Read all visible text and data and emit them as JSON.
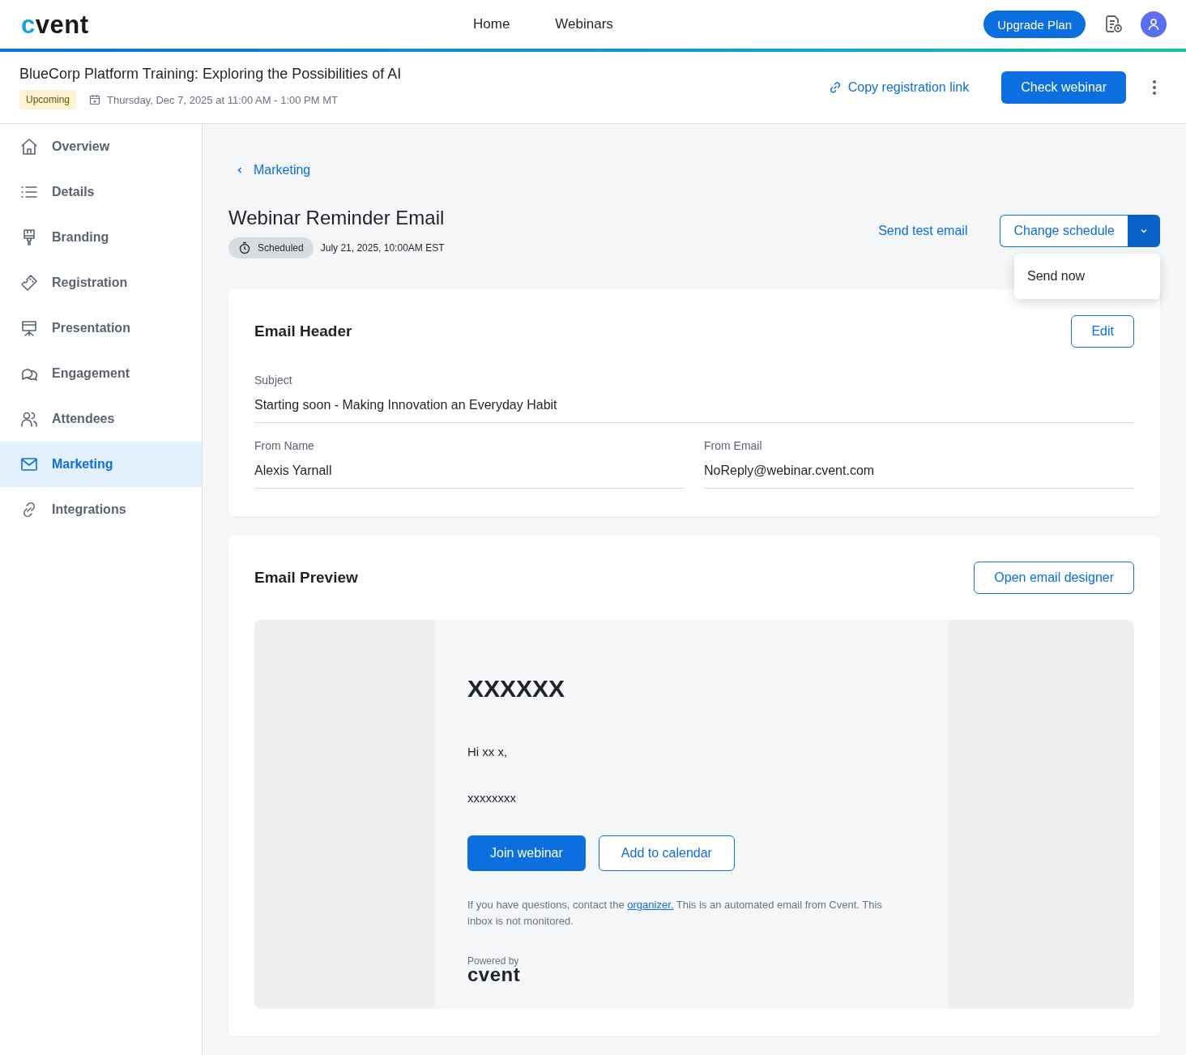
{
  "topbar": {
    "logo": {
      "accent": "c",
      "rest": "vent"
    },
    "nav": [
      {
        "label": "Home",
        "selected": false
      },
      {
        "label": "Webinars",
        "selected": false
      }
    ],
    "upgrade_button": "Upgrade Plan"
  },
  "event": {
    "title": "BlueCorp Platform Training: Exploring the Possibilities of AI",
    "status": "Upcoming",
    "datetime": "Thursday, Dec 7, 2025 at 11:00 AM - 1:00 PM MT",
    "copy_link": "Copy registration link",
    "check_button": "Check webinar"
  },
  "sidebar": {
    "items": [
      {
        "label": "Overview",
        "selected": false
      },
      {
        "label": "Details",
        "selected": false
      },
      {
        "label": "Branding",
        "selected": false
      },
      {
        "label": "Registration",
        "selected": false
      },
      {
        "label": "Presentation",
        "selected": false
      },
      {
        "label": "Engagement",
        "selected": false
      },
      {
        "label": "Attendees",
        "selected": false
      },
      {
        "label": "Marketing",
        "selected": true
      },
      {
        "label": "Integrations",
        "selected": false
      }
    ]
  },
  "breadcrumb": "Marketing",
  "email": {
    "title": "Webinar Reminder Email",
    "status": "Scheduled",
    "schedule": "July 21, 2025, 10:00AM EST",
    "send_test": "Send test email",
    "change_schedule": "Change schedule",
    "menu": {
      "expanded": true,
      "items": [
        "Send now"
      ]
    }
  },
  "header_card": {
    "title": "Email Header",
    "edit": "Edit",
    "fields": [
      {
        "label": "Subject",
        "value": "Starting soon - Making Innovation an Everyday Habit"
      },
      {
        "label": "From Name",
        "value": "Alexis Yarnall"
      },
      {
        "label": "From Email",
        "value": "NoReply@webinar.cvent.com"
      }
    ]
  },
  "preview_card": {
    "title": "Email Preview",
    "open_designer": "Open email designer",
    "heading": "XXXXXX",
    "greeting": "Hi xx x,",
    "body": "xxxxxxxx",
    "join_button": "Join webinar",
    "calendar_button": "Add to calendar",
    "disclaimer": {
      "before": "If you have questions, contact the ",
      "link": "organizer.",
      "after": " This is an automated email from Cvent. This inbox is not monitored."
    },
    "powered_by": "Powered by",
    "footer_logo": "cvent"
  }
}
